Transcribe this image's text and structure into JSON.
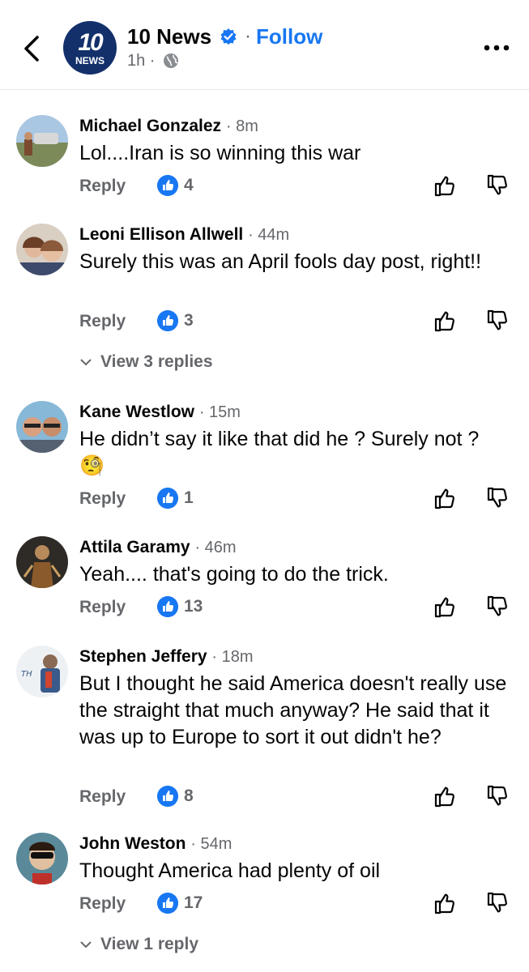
{
  "header": {
    "page_name": "10 News",
    "logo_top": "10",
    "logo_bottom": "NEWS",
    "separator": "·",
    "follow_label": "Follow",
    "time": "1h ·"
  },
  "comments": [
    {
      "author": "Michael Gonzalez",
      "time": "· 8m",
      "text": "Lol....Iran is so winning this war",
      "reply_label": "Reply",
      "likes": "4"
    },
    {
      "author": "Leoni Ellison Allwell",
      "time": "· 44m",
      "text": "Surely this was an April fools day post, right!!",
      "reply_label": "Reply",
      "likes": "3",
      "view_replies": "View 3 replies"
    },
    {
      "author": "Kane Westlow",
      "time": "· 15m",
      "text": "He didn’t say it like that did he ? Surely not ?",
      "emoji": "🧐",
      "reply_label": "Reply",
      "likes": "1"
    },
    {
      "author": "Attila Garamy",
      "time": "· 46m",
      "text": "Yeah.... that's going to do the trick.",
      "reply_label": "Reply",
      "likes": "13"
    },
    {
      "author": "Stephen Jeffery",
      "time": "· 18m",
      "text": "But I thought he said America doesn't really use the straight that much anyway? He said that it was up to Europe to sort it out didn't he?",
      "reply_label": "Reply",
      "likes": "8"
    },
    {
      "author": "John Weston",
      "time": "· 54m",
      "text": "Thought America had plenty of oil",
      "reply_label": "Reply",
      "likes": "17",
      "view_replies": "View 1 reply"
    }
  ],
  "icons": {
    "back": "chevron-left-icon",
    "verified": "verified-badge-icon",
    "globe": "globe-icon",
    "more": "more-icon",
    "like": "thumbs-up-icon",
    "dislike": "thumbs-down-icon"
  },
  "colors": {
    "accent": "#1877f2",
    "secondary_text": "#65676b",
    "logo_bg": "#13306b"
  }
}
